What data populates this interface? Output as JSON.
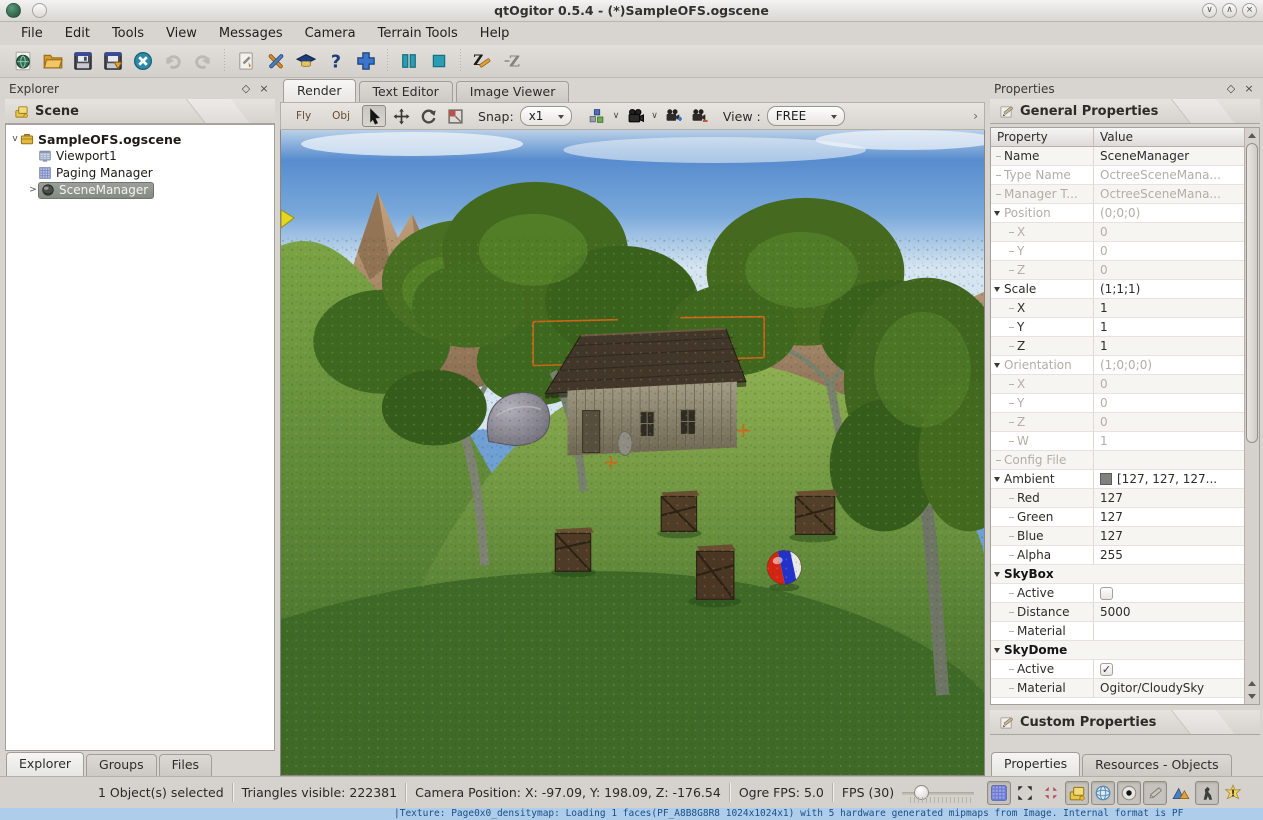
{
  "window": {
    "title": "qtOgitor 0.5.4 - (*)SampleOFS.ogscene",
    "controls": [
      {
        "name": "shade-button",
        "glyph": "∨"
      },
      {
        "name": "maximize-button",
        "glyph": "∧"
      },
      {
        "name": "close-button",
        "glyph": "×"
      }
    ]
  },
  "menu": {
    "items": [
      "File",
      "Edit",
      "Tools",
      "View",
      "Messages",
      "Camera",
      "Terrain Tools",
      "Help"
    ]
  },
  "toolbar": {
    "buttons": [
      {
        "name": "open-scene-button",
        "icon": "scene-sphere-icon"
      },
      {
        "name": "open-folder-button",
        "icon": "open-folder-icon"
      },
      {
        "name": "save-button",
        "icon": "save-icon"
      },
      {
        "name": "save-as-button",
        "icon": "save-as-icon"
      },
      {
        "name": "close-scene-button",
        "icon": "close-circle-icon"
      },
      {
        "name": "undo-button",
        "icon": "undo-icon",
        "disabled": true
      },
      {
        "name": "redo-button",
        "icon": "redo-icon",
        "disabled": true
      },
      {
        "sep": true
      },
      {
        "name": "scene-options-button",
        "icon": "doc-tools-icon"
      },
      {
        "name": "preferences-button",
        "icon": "tools-icon"
      },
      {
        "name": "help-contents-button",
        "icon": "grad-cap-icon"
      },
      {
        "name": "about-button",
        "icon": "help-question-icon"
      },
      {
        "name": "add-object-button",
        "icon": "plus-cross-icon"
      },
      {
        "sep": true
      },
      {
        "name": "pause-button",
        "icon": "pause-icon"
      },
      {
        "name": "stop-button",
        "icon": "stop-icon"
      },
      {
        "sep": true
      },
      {
        "name": "z-order-edit-button",
        "icon": "z-pencil-icon"
      },
      {
        "name": "z-order-button",
        "icon": "z-gray-icon",
        "disabled": true
      }
    ]
  },
  "explorer": {
    "title": "Explorer",
    "float_glyph": "◇",
    "close_glyph": "×",
    "scene_header": "Scene",
    "tree": [
      {
        "label": "SampleOFS.ogscene",
        "icon": "case-icon",
        "bold": true,
        "twist": "v",
        "level": 0
      },
      {
        "label": "Viewport1",
        "icon": "viewport-icon",
        "level": 1
      },
      {
        "label": "Paging Manager",
        "icon": "paging-grid-icon",
        "level": 1
      },
      {
        "label": "SceneManager",
        "icon": "scenemanager-sphere-icon",
        "level": 1,
        "selected": true,
        "twist": ">"
      }
    ],
    "tabs": [
      "Explorer",
      "Groups",
      "Files"
    ],
    "active_tab": "Explorer"
  },
  "center": {
    "tabs": [
      "Render",
      "Text Editor",
      "Image Viewer"
    ],
    "active_tab": "Render",
    "render_toolbar": {
      "fly_label": "Fly",
      "obj_label": "Obj",
      "tools": [
        {
          "name": "select-tool",
          "icon": "cursor-arrow-icon",
          "pressed": true
        },
        {
          "name": "move-tool",
          "icon": "move-cross-icon"
        },
        {
          "name": "rotate-tool",
          "icon": "rotate-arrow-icon"
        },
        {
          "name": "scale-tool",
          "icon": "scale-rect-icon"
        }
      ],
      "snap_label": "Snap:",
      "snap_value": "x1",
      "camera_tools": [
        {
          "name": "object-display-tool",
          "icon": "snap-cubes-icon",
          "dropdown": true
        },
        {
          "name": "camera-mode-tool",
          "icon": "camera-icon",
          "dropdown": true
        },
        {
          "name": "camera-add-tool",
          "icon": "camera-plus-icon"
        },
        {
          "name": "camera-remove-tool",
          "icon": "camera-minus-icon"
        }
      ],
      "view_label": "View :",
      "view_value": "FREE",
      "overflow_glyph": "›"
    }
  },
  "properties": {
    "title": "Properties",
    "float_glyph": "◇",
    "close_glyph": "×",
    "general_header": "General Properties",
    "custom_header": "Custom Properties",
    "columns": [
      "Property",
      "Value"
    ],
    "rows": [
      {
        "p": "Name",
        "v": "SceneManager"
      },
      {
        "p": "Type Name",
        "v": "OctreeSceneMana...",
        "gray": true
      },
      {
        "p": "Manager T...",
        "v": "OctreeSceneMana...",
        "gray": true
      },
      {
        "p": "Position",
        "v": "(0;0;0)",
        "gray": true,
        "chev": true
      },
      {
        "p": "X",
        "v": "0",
        "gray": true,
        "child": true
      },
      {
        "p": "Y",
        "v": "0",
        "gray": true,
        "child": true
      },
      {
        "p": "Z",
        "v": "0",
        "gray": true,
        "child": true
      },
      {
        "p": "Scale",
        "v": "(1;1;1)",
        "chev": true
      },
      {
        "p": "X",
        "v": "1",
        "child": true
      },
      {
        "p": "Y",
        "v": "1",
        "child": true
      },
      {
        "p": "Z",
        "v": "1",
        "child": true
      },
      {
        "p": "Orientation",
        "v": "(1;0;0;0)",
        "gray": true,
        "chev": true
      },
      {
        "p": "X",
        "v": "0",
        "gray": true,
        "child": true
      },
      {
        "p": "Y",
        "v": "0",
        "gray": true,
        "child": true
      },
      {
        "p": "Z",
        "v": "0",
        "gray": true,
        "child": true
      },
      {
        "p": "W",
        "v": "1",
        "gray": true,
        "child": true
      },
      {
        "p": "Config File",
        "v": "",
        "gray": true
      },
      {
        "p": "Ambient",
        "v": "[127, 127, 127...",
        "chev": true,
        "swatch": "#808080"
      },
      {
        "p": "Red",
        "v": "127",
        "child": true
      },
      {
        "p": "Green",
        "v": "127",
        "child": true
      },
      {
        "p": "Blue",
        "v": "127",
        "child": true
      },
      {
        "p": "Alpha",
        "v": "255",
        "child": true
      },
      {
        "p": "SkyBox",
        "v": "",
        "bold": true,
        "chev": true,
        "grp": true
      },
      {
        "p": "Active",
        "v": "",
        "child": true,
        "checkbox": "off"
      },
      {
        "p": "Distance",
        "v": "5000",
        "child": true
      },
      {
        "p": "Material",
        "v": "",
        "child": true
      },
      {
        "p": "SkyDome",
        "v": "",
        "bold": true,
        "chev": true,
        "grp": true
      },
      {
        "p": "Active",
        "v": "",
        "child": true,
        "checkbox": "on"
      },
      {
        "p": "Material",
        "v": "Ogitor/CloudySky",
        "child": true
      }
    ],
    "tabs": [
      "Properties",
      "Resources - Objects"
    ],
    "active_tab": "Properties"
  },
  "statusbar": {
    "selected_text": "1 Object(s) selected",
    "triangles_text": "Triangles visible: 222381",
    "camera_text": "Camera Position: X: -97.09, Y:  198.09, Z: -176.54",
    "ogre_fps_text": "Ogre FPS: 5.0",
    "fps_text": "FPS (30)",
    "icons": [
      {
        "name": "grid-toggle-button",
        "icon": "grid-blue-icon",
        "pressed": true
      },
      {
        "name": "expand-view-button",
        "icon": "expand-arrows-icon"
      },
      {
        "name": "contract-view-button",
        "icon": "contract-arrows-icon"
      },
      {
        "name": "scene-hierarchy-toggle",
        "icon": "layers-yellow-icon",
        "pressed": true
      },
      {
        "name": "sphere-display-toggle",
        "icon": "wire-sphere-icon",
        "pressed": true
      },
      {
        "name": "focus-toggle",
        "icon": "dot-eye-icon",
        "pressed": true
      },
      {
        "name": "edit-mode-toggle",
        "icon": "pencil-icon",
        "pressed": true
      },
      {
        "name": "terrain-display-toggle",
        "icon": "mountains-icon"
      },
      {
        "name": "walk-mode-toggle",
        "icon": "walker-icon",
        "pressed": true
      },
      {
        "name": "warning-indicator",
        "icon": "warn-icon"
      }
    ]
  },
  "log": {
    "text": "|Texture: Page0x0_densitymap: Loading 1 faces(PF_A8B8G8R8 1024x1024x1) with 5 hardware generated mipmaps from Image. Internal format is PF"
  }
}
